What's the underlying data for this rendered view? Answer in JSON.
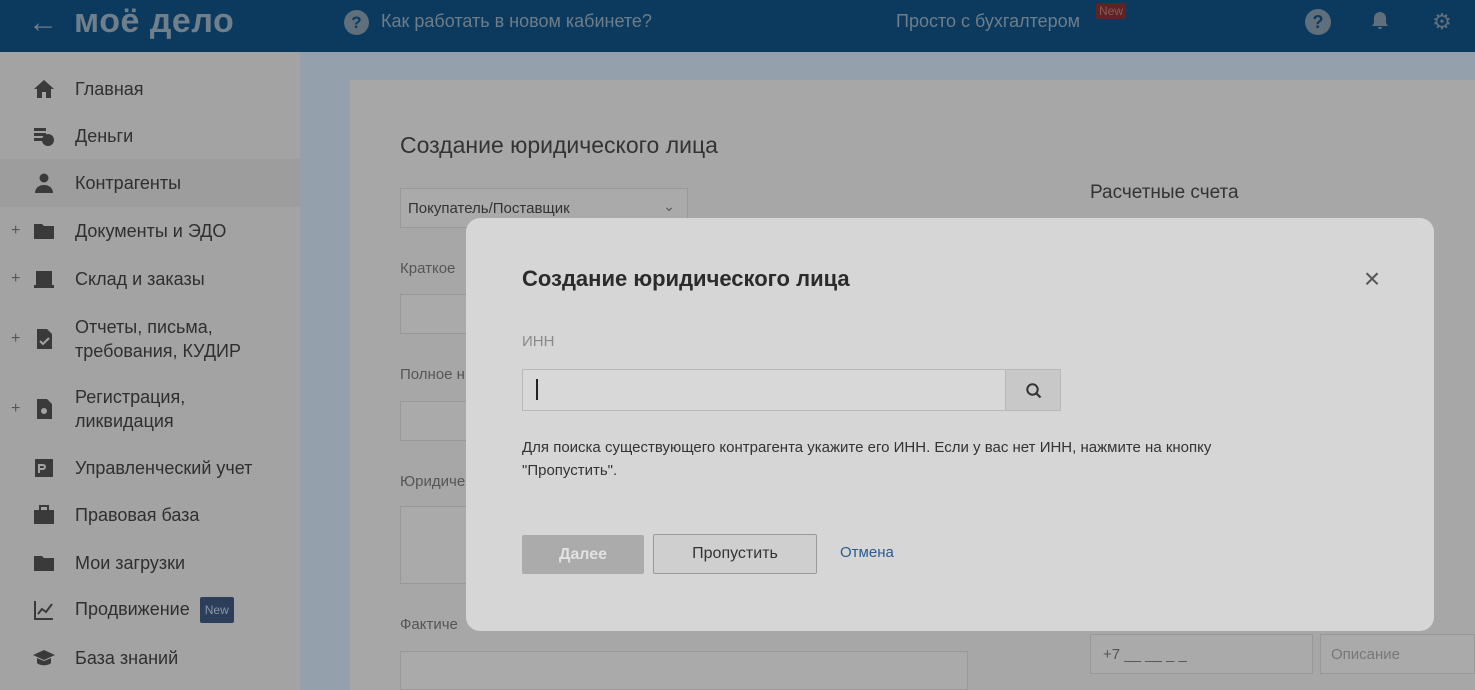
{
  "header": {
    "back_icon": "arrow-left-icon",
    "logo": "моё дело",
    "how_to_link": "Как работать в новом кабинете?",
    "simple_accountant": "Просто с бухгалтером",
    "new_badge": "New",
    "icons": [
      "help-icon",
      "bell-icon",
      "gear-icon"
    ]
  },
  "sidebar": {
    "items": [
      {
        "label": "Главная",
        "icon": "home-icon",
        "expandable": false
      },
      {
        "label": "Деньги",
        "icon": "money-icon",
        "expandable": false
      },
      {
        "label": "Контрагенты",
        "icon": "contractor-icon",
        "expandable": false,
        "active": true
      },
      {
        "label": "Документы и ЭДО",
        "icon": "folder-icon",
        "expandable": true
      },
      {
        "label": "Склад и заказы",
        "icon": "warehouse-icon",
        "expandable": true
      },
      {
        "label": "Отчеты, письма, требования, КУДИР",
        "line1": "Отчеты, письма,",
        "line2": "требования, КУДИР",
        "icon": "report-icon",
        "expandable": true
      },
      {
        "label": "Регистрация, ликвидация",
        "line1": "Регистрация,",
        "line2": "ликвидация",
        "icon": "registration-icon",
        "expandable": true
      },
      {
        "label": "Управленческий учет",
        "icon": "management-icon",
        "expandable": false
      },
      {
        "label": "Правовая база",
        "icon": "briefcase-icon",
        "expandable": false
      },
      {
        "label": "Мои загрузки",
        "icon": "folder-icon",
        "expandable": false
      },
      {
        "label": "Продвижение",
        "icon": "chart-icon",
        "expandable": false,
        "badge": "New"
      },
      {
        "label": "База знаний",
        "icon": "graduation-cap-icon",
        "expandable": false
      }
    ]
  },
  "background_form": {
    "title": "Создание юридического лица",
    "type_select": "Покупатель/Поставщик",
    "short_name_label": "Краткое",
    "full_name_label": "Полное н",
    "legal_address_label": "Юридиче",
    "actual_address_label": "Фактиче",
    "accounts_title": "Расчетные счета",
    "phone_placeholder": "+7 __ __ _ _",
    "description_placeholder": "Описание"
  },
  "modal": {
    "title": "Создание юридического лица",
    "inn_label": "ИНН",
    "inn_value": "",
    "hint": "Для поиска существующего контрагента укажите его ИНН. Если у вас нет ИНН, нажмите на кнопку \"Пропустить\".",
    "next_button": "Далее",
    "skip_button": "Пропустить",
    "cancel_link": "Отмена"
  }
}
